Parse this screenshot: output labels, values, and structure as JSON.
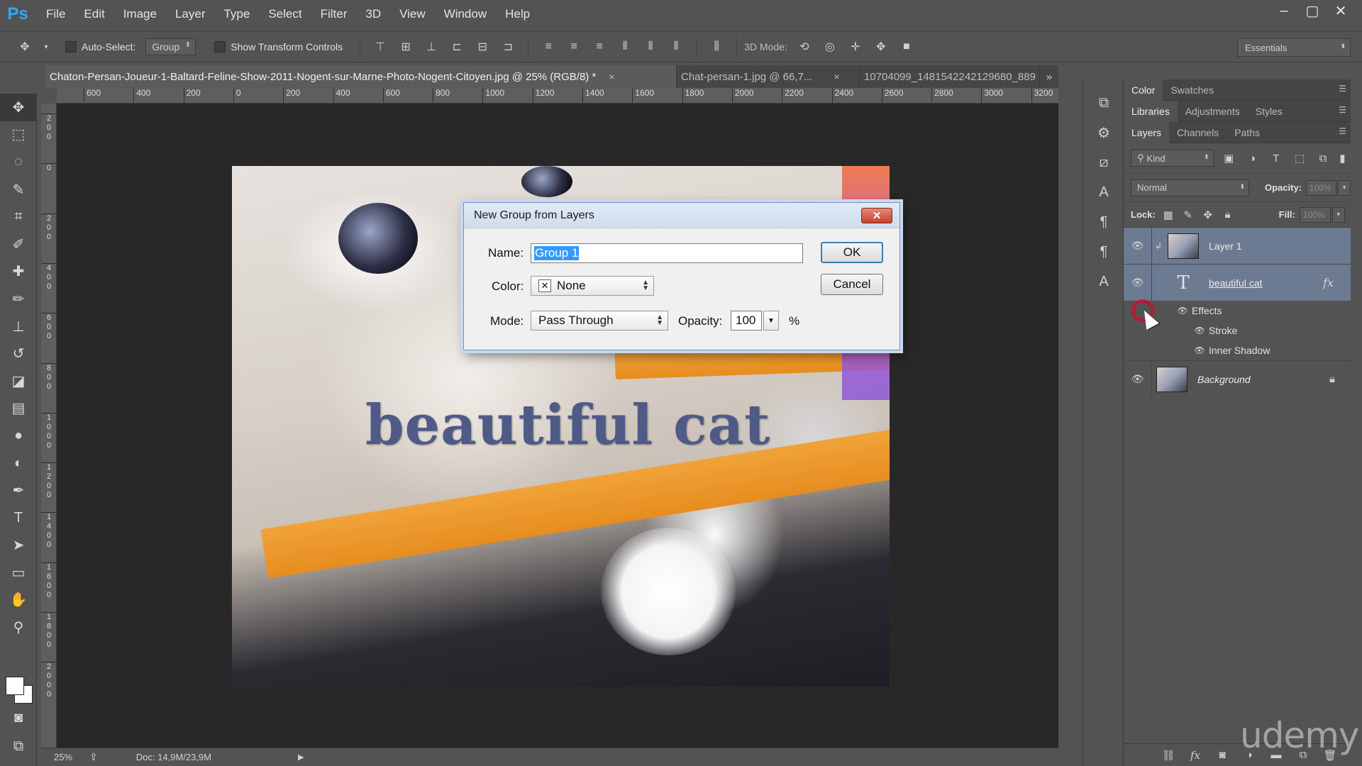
{
  "app": {
    "logo": "Ps",
    "menu": [
      "File",
      "Edit",
      "Image",
      "Layer",
      "Type",
      "Select",
      "Filter",
      "3D",
      "View",
      "Window",
      "Help"
    ],
    "window_controls": [
      "–",
      "▢",
      "✕"
    ]
  },
  "options_bar": {
    "auto_select_label": "Auto-Select:",
    "auto_select_value": "Group",
    "show_transform_label": "Show Transform Controls",
    "mode_3d_label": "3D Mode:",
    "workspace": "Essentials"
  },
  "document_tabs": [
    {
      "label": "Chaton-Persan-Joueur-1-Baltard-Feline-Show-2011-Nogent-sur-Marne-Photo-Nogent-Citoyen.jpg @ 25% (RGB/8) *",
      "close": "×",
      "active": true
    },
    {
      "label": "Chat-persan-1.jpg @ 66,7...",
      "close": "×",
      "active": false
    },
    {
      "label": "10704099_1481542242129680_889",
      "close": "",
      "active": false
    }
  ],
  "tabs_overflow": "»",
  "ruler_top": [
    "600",
    "400",
    "200",
    "0",
    "200",
    "400",
    "600",
    "800",
    "1000",
    "1200",
    "1400",
    "1600",
    "1800",
    "2000",
    "2200",
    "2400",
    "2600",
    "2800",
    "3000",
    "3200"
  ],
  "ruler_left": [
    "2\n0\n0",
    "0",
    "2\n0\n0",
    "4\n0\n0",
    "6\n0\n0",
    "8\n0\n0",
    "1\n0\n0\n0",
    "1\n2\n0\n0",
    "1\n4\n0\n0",
    "1\n6\n0\n0",
    "1\n8\n0\n0",
    "2\n0\n0\n0"
  ],
  "canvas": {
    "text": "beautiful cat"
  },
  "status": {
    "zoom": "25%",
    "doc": "Doc: 14,9M/23,9M"
  },
  "panels": {
    "group1_tabs": [
      "Color",
      "Swatches"
    ],
    "group2_tabs": [
      "Libraries",
      "Adjustments",
      "Styles"
    ],
    "group3_tabs": [
      "Layers",
      "Channels",
      "Paths"
    ],
    "kind_label": "Kind",
    "blend_mode": "Normal",
    "opacity_label": "Opacity:",
    "opacity_value": "100%",
    "lock_label": "Lock:",
    "fill_label": "Fill:",
    "fill_value": "100%",
    "layers": {
      "layer1": "Layer 1",
      "text_layer": "beautiful cat",
      "effects": "Effects",
      "stroke": "Stroke",
      "inner_shadow": "Inner Shadow",
      "background": "Background",
      "fx": "fx"
    }
  },
  "dialog": {
    "title": "New Group from Layers",
    "close": "✕",
    "name_label": "Name:",
    "name_value": "Group 1",
    "color_label": "Color:",
    "color_x": "✕",
    "color_value": "None",
    "mode_label": "Mode:",
    "mode_value": "Pass Through",
    "opacity_label": "Opacity:",
    "opacity_value": "100",
    "percent": "%",
    "ok": "OK",
    "cancel": "Cancel"
  },
  "watermark": "udemy"
}
